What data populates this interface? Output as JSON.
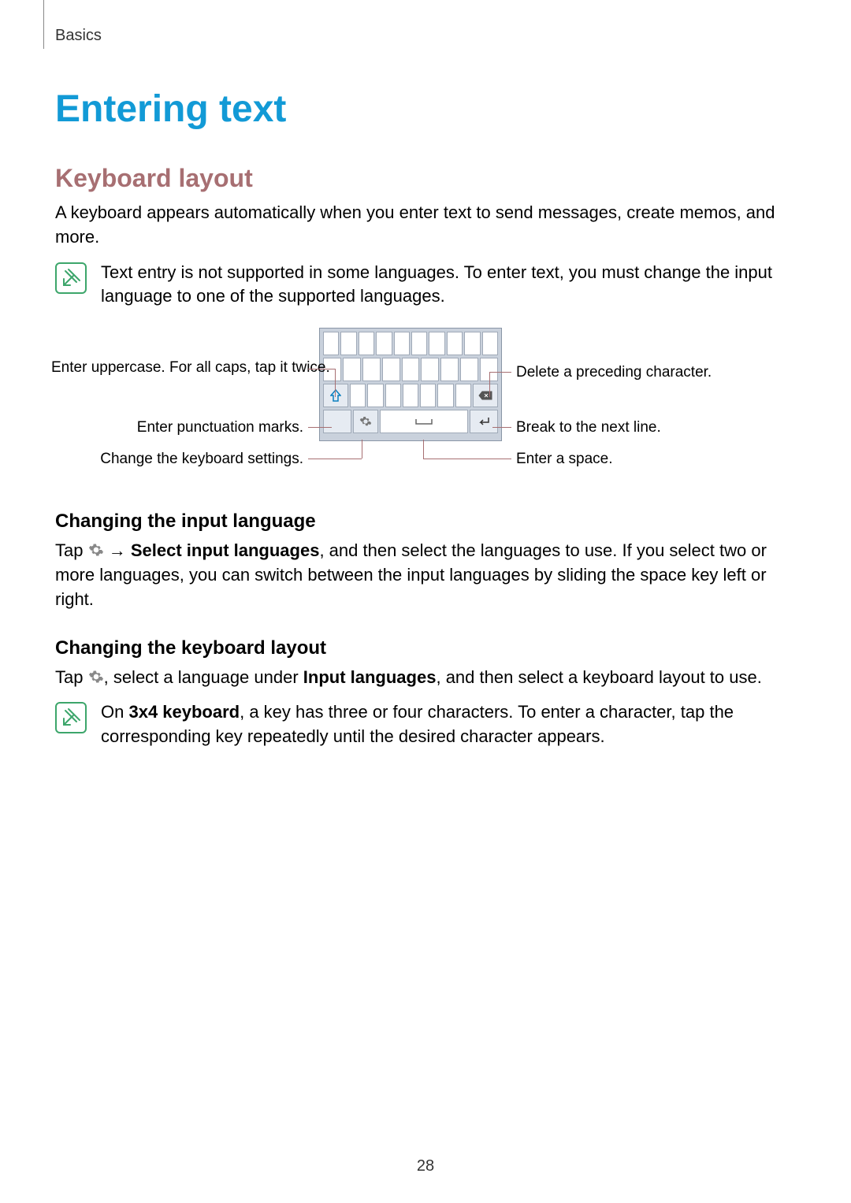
{
  "breadcrumb": "Basics",
  "title": "Entering text",
  "section1": {
    "heading": "Keyboard layout",
    "para": "A keyboard appears automatically when you enter text to send messages, create memos, and more.",
    "note": "Text entry is not supported in some languages. To enter text, you must change the input language to one of the supported languages."
  },
  "callouts": {
    "left1": "Enter uppercase. For all caps, tap it twice.",
    "left2": "Enter punctuation marks.",
    "left3": "Change the keyboard settings.",
    "right1": "Delete a preceding character.",
    "right2": "Break to the next line.",
    "right3": "Enter a space."
  },
  "sub1": {
    "heading": "Changing the input language",
    "p_pre": "Tap ",
    "p_arrow": " → ",
    "p_bold": "Select input languages",
    "p_post": ", and then select the languages to use. If you select two or more languages, you can switch between the input languages by sliding the space key left or right."
  },
  "sub2": {
    "heading": "Changing the keyboard layout",
    "p_pre": "Tap ",
    "p_mid": ", select a language under ",
    "p_bold": "Input languages",
    "p_post": ", and then select a keyboard layout to use.",
    "note_pre": "On ",
    "note_bold": "3x4 keyboard",
    "note_post": ", a key has three or four characters. To enter a character, tap the corresponding key repeatedly until the desired character appears."
  },
  "page_number": "28"
}
